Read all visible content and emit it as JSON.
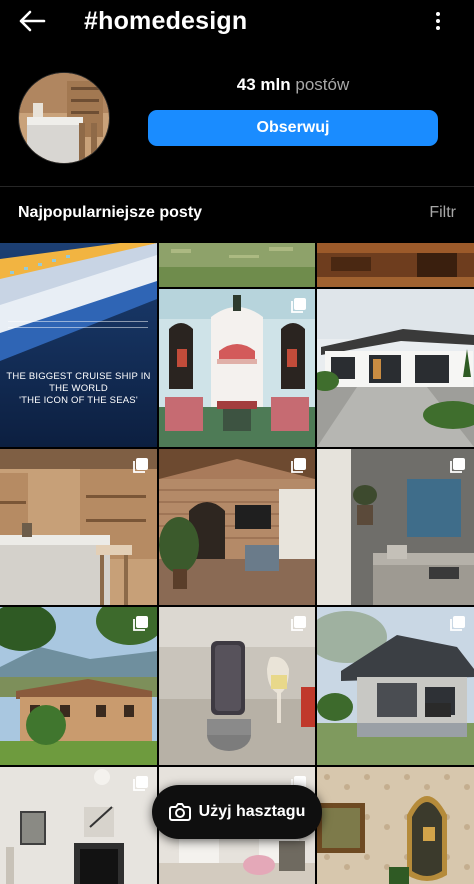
{
  "header": {
    "title": "#homedesign",
    "back_icon": "arrow-left-icon",
    "more_icon": "more-vertical-icon"
  },
  "profile": {
    "post_count_value": "43 mln",
    "post_count_label": "postów",
    "follow_label": "Obserwuj",
    "follow_color": "#1a8cff"
  },
  "section": {
    "title": "Najpopularniejsze posty",
    "filter_label": "Filtr"
  },
  "posts": [
    {
      "caption_line1": "THE BIGGEST CRUISE SHIP IN THE WORLD",
      "caption_line2": "'THE ICON OF THE SEAS'"
    }
  ],
  "fab": {
    "label": "Użyj hasztagu",
    "icon": "camera-icon"
  }
}
